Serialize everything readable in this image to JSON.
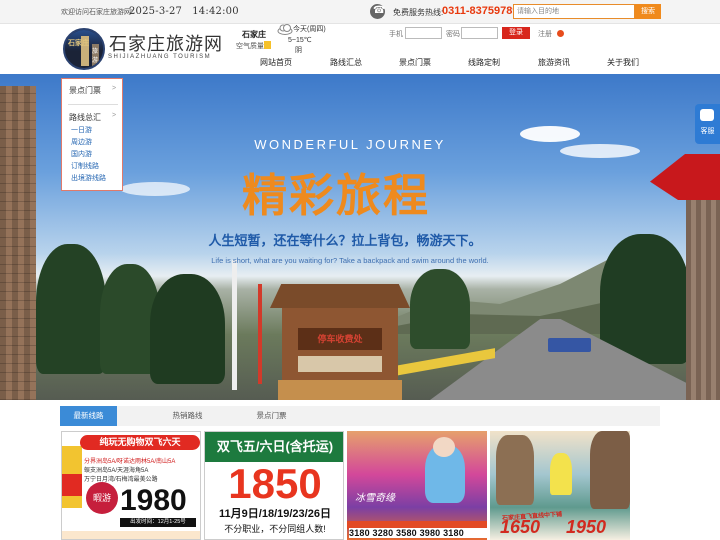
{
  "topbar": {
    "welcome": "欢迎访问石家庄旅游网!",
    "date": "2025-3-27",
    "time": "14:42:00",
    "hotline_label": "免费服务热线:",
    "hotline_number": "0311-83759789",
    "search_placeholder": "请输入目的地",
    "search_button": "搜索"
  },
  "header": {
    "site_name": "石家庄旅游网",
    "site_subtitle": "SHIJIAZHUANG TOURISM",
    "logo_text": [
      "石家庄",
      "旅游"
    ],
    "city": "石家庄",
    "air_quality_label": "空气质量:",
    "weather_day": "今天(周四)",
    "weather_temp": "5~15℃",
    "weather_cond": "阴",
    "weather_icon": "cloud-icon",
    "login": {
      "phone_label": "手机",
      "password_label": "密码",
      "login_button": "登录",
      "register_link": "注册"
    }
  },
  "nav": [
    "网站首页",
    "路线汇总",
    "景点门票",
    "线路定制",
    "旅游资讯",
    "关于我们"
  ],
  "dropdown": {
    "sections": [
      {
        "title": "景点门票",
        "items": []
      },
      {
        "title": "路线总汇",
        "items": [
          "一日游",
          "周边游",
          "国内游",
          "订制线路",
          "出境游线路"
        ]
      }
    ]
  },
  "banner": {
    "english_title": "WONDERFUL JOURNEY",
    "title": "精彩旅程",
    "slogan": "人生短暂，还在等什么？拉上背包，畅游天下。",
    "slogan_en": "Life is short, what are you waiting for? Take a backpack and swim around the world.",
    "booth_sign": "停车收费处"
  },
  "service_tab": {
    "label": "客服",
    "icon": "chat-icon"
  },
  "tabs": [
    {
      "label": "最新线路",
      "active": true
    },
    {
      "label": "热销路线",
      "active": false
    },
    {
      "label": "景点门票",
      "active": false
    }
  ],
  "cards": [
    {
      "header": "纯玩无购物双飞六天",
      "lines": [
        "分界洲岛5A/呀诺达雨林5A/南山5A",
        "蜈支洲岛5A/天涯海角5A",
        "万宁日月湾/石梅湾最美公路"
      ],
      "badge": "暇游",
      "price": "1980",
      "date": "出发时间：12月1-25号"
    },
    {
      "header": "双飞五/六日(含托运)",
      "price": "1850",
      "date": "11月9日/18/19/23/26日",
      "footer": "不分职业，不分同组人数!"
    },
    {
      "title": "冰雪奇缘",
      "prices": "3180 3280 3580 3980 3180"
    },
    {
      "ribbon": "石家庄直飞直线中下铺",
      "price_a": "1650",
      "price_b": "1950"
    }
  ],
  "colors": {
    "accent_orange": "#f08a1c",
    "hotline_red": "#e8390e",
    "tab_blue": "#3b8bd7",
    "login_red": "#d8261c"
  }
}
